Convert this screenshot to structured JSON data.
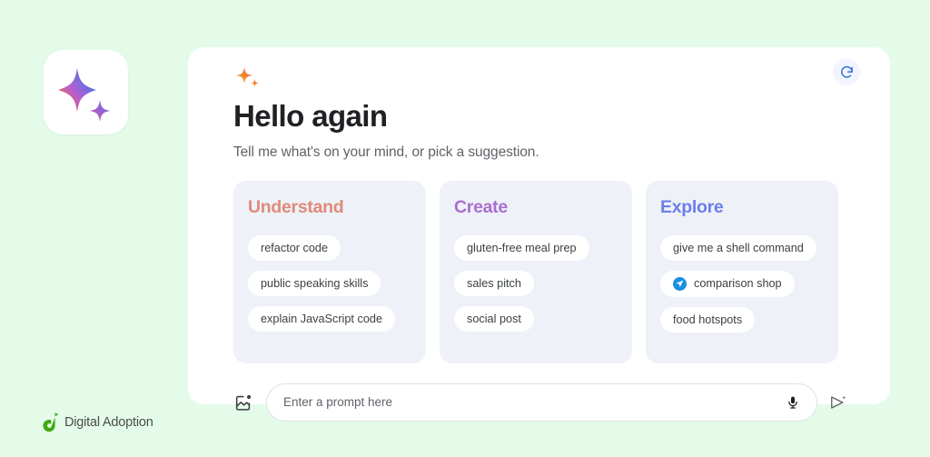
{
  "theme": {
    "page_background": "#e4fbea",
    "panel_background": "#ffffff",
    "card_background": "#eef1f8",
    "chip_background": "#ffffff",
    "accent_understand": "#e08a7a",
    "accent_create": "#a96fd0",
    "accent_explore": "#6c7ee8",
    "refresh_accent": "#3b6fe0",
    "cursor_badge": "#1a8fe3",
    "brand_green": "#43a814"
  },
  "app_icon": {
    "name": "gemini-sparkle-app-icon",
    "gradient_from": "#ef7b45",
    "gradient_mid": "#b35fd0",
    "gradient_to": "#3b82f6"
  },
  "header": {
    "sparkle_icon": "sparkle-icon",
    "title": "Hello again",
    "subtitle": "Tell me what's on your mind, or pick a suggestion.",
    "refresh_icon": "refresh-icon",
    "refresh_label": "Refresh suggestions"
  },
  "cards": [
    {
      "title": "Understand",
      "color": "#e08a7a",
      "chips": [
        {
          "label": "refactor code",
          "cursor": false
        },
        {
          "label": "public speaking skills",
          "cursor": false
        },
        {
          "label": "explain JavaScript code",
          "cursor": false
        }
      ]
    },
    {
      "title": "Create",
      "color": "#a96fd0",
      "chips": [
        {
          "label": "gluten-free meal prep",
          "cursor": false
        },
        {
          "label": "sales pitch",
          "cursor": false
        },
        {
          "label": "social post",
          "cursor": false
        }
      ]
    },
    {
      "title": "Explore",
      "color": "#6c7ee8",
      "chips": [
        {
          "label": "give me a shell command",
          "cursor": false
        },
        {
          "label": "comparison shop",
          "cursor": true
        },
        {
          "label": "food hotspots",
          "cursor": false
        }
      ]
    }
  ],
  "prompt_bar": {
    "add_image_icon": "add-image-icon",
    "placeholder": "Enter a prompt here",
    "value": "",
    "mic_icon": "microphone-icon",
    "send_icon": "send-icon"
  },
  "brand": {
    "mark": "digital-adoption-logo-mark",
    "name": "Digital Adoption"
  }
}
